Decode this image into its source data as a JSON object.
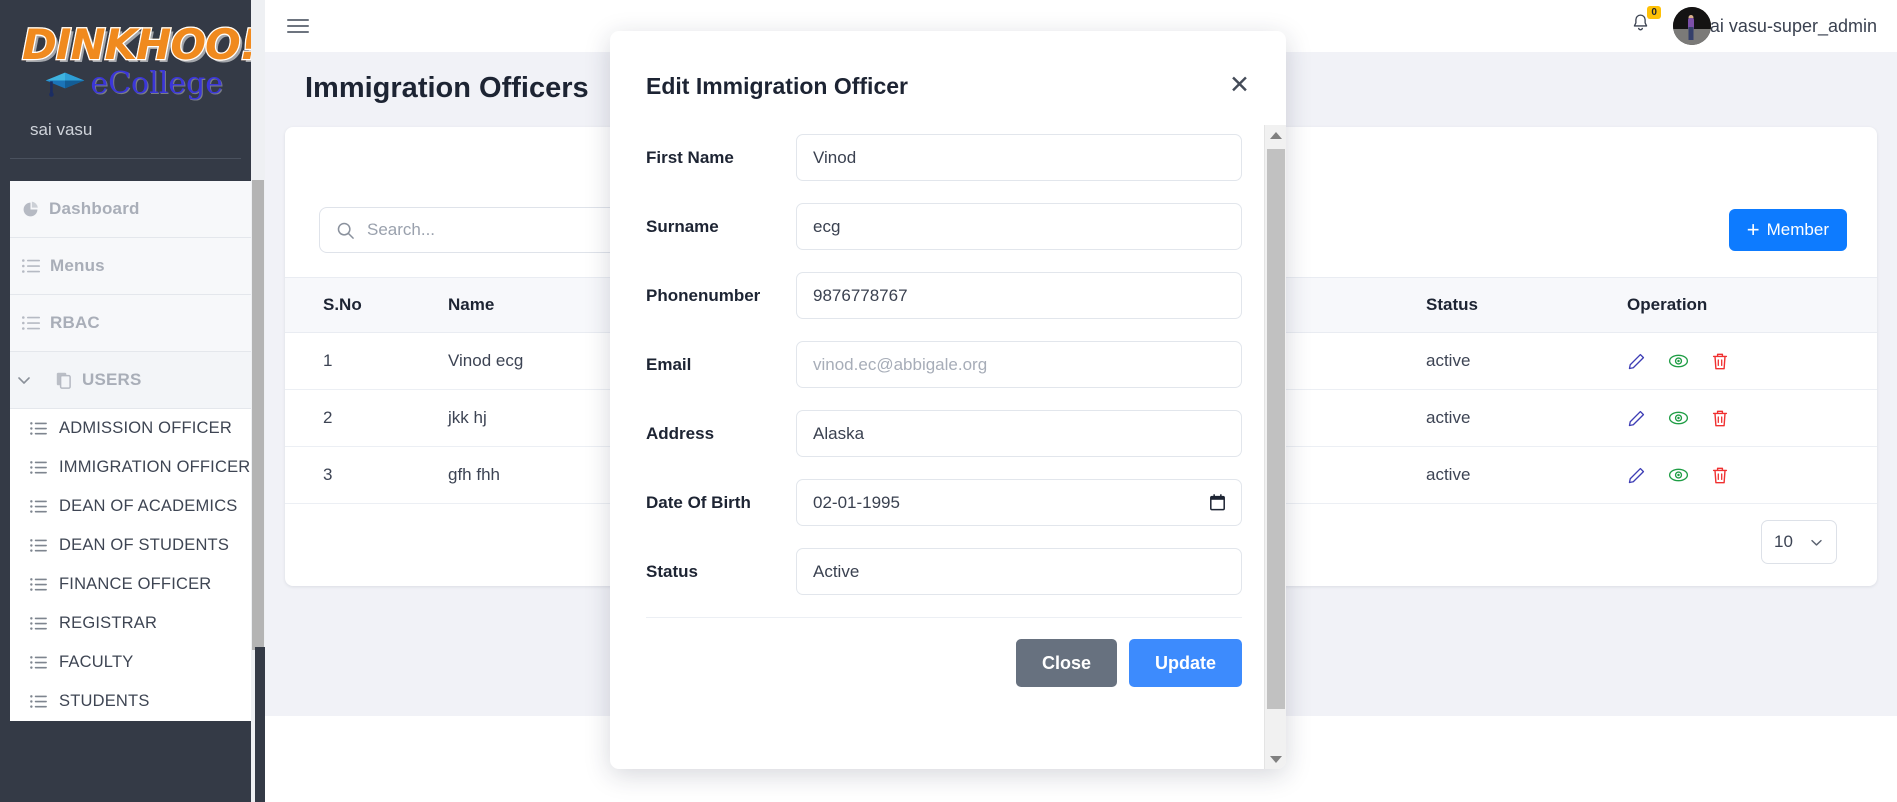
{
  "brand": {
    "word": "DINKHOO!",
    "sub": "eCollege",
    "cap_icon": "graduation-cap-icon",
    "user": "sai vasu"
  },
  "sidebar": {
    "groups": [
      {
        "label": "Dashboard",
        "icon": "pie-chart-icon",
        "expandable": false
      },
      {
        "label": "Menus",
        "icon": "list-icon",
        "expandable": false
      },
      {
        "label": "RBAC",
        "icon": "list-icon",
        "expandable": false
      },
      {
        "label": "USERS",
        "icon": "copy-icon",
        "expandable": true,
        "chevron": "chevron-down-icon"
      }
    ],
    "items": [
      {
        "label": "ADMISSION OFFICER",
        "icon": "list-icon"
      },
      {
        "label": "IMMIGRATION OFFICER",
        "icon": "list-icon"
      },
      {
        "label": "DEAN OF ACADEMICS",
        "icon": "list-icon"
      },
      {
        "label": "DEAN OF STUDENTS",
        "icon": "list-icon"
      },
      {
        "label": "FINANCE OFFICER",
        "icon": "list-icon"
      },
      {
        "label": "REGISTRAR",
        "icon": "list-icon"
      },
      {
        "label": "FACULTY",
        "icon": "list-icon"
      },
      {
        "label": "STUDENTS",
        "icon": "list-icon"
      }
    ]
  },
  "topbar": {
    "menu_icon": "hamburger-icon",
    "bell_icon": "bell-icon",
    "notification_count": "0",
    "avatar": "user-avatar",
    "user_label": "sai vasu-super_admin"
  },
  "page": {
    "title": "Immigration Officers",
    "search_placeholder": "Search...",
    "search_icon": "search-icon",
    "add_button": "Member",
    "add_button_plus": "+",
    "page_size": "10",
    "page_size_chevron": "chevron-down-icon"
  },
  "table": {
    "columns": [
      "S.No",
      "Name",
      "Status",
      "Operation"
    ],
    "rows": [
      {
        "sno": "1",
        "name": "Vinod ecg",
        "status": "active"
      },
      {
        "sno": "2",
        "name": "jkk hj",
        "status": "active"
      },
      {
        "sno": "3",
        "name": "gfh fhh",
        "status": "active"
      }
    ],
    "operations": [
      "edit-pencil-icon",
      "view-eye-icon",
      "delete-trash-icon"
    ]
  },
  "modal": {
    "title": "Edit Immigration Officer",
    "close_icon": "close-icon",
    "fields": [
      {
        "label": "First Name",
        "value": "Vinod",
        "is_placeholder": false
      },
      {
        "label": "Surname",
        "value": "ecg",
        "is_placeholder": false
      },
      {
        "label": "Phonenumber",
        "value": "9876778767",
        "is_placeholder": false
      },
      {
        "label": "Email",
        "value": "vinod.ec@abbigale.org",
        "is_placeholder": true
      },
      {
        "label": "Address",
        "value": "Alaska",
        "is_placeholder": false
      },
      {
        "label": "Date Of Birth",
        "value": "02-01-1995",
        "is_placeholder": false,
        "icon": "calendar-icon"
      },
      {
        "label": "Status",
        "value": "Active",
        "is_placeholder": false
      }
    ],
    "close_button": "Close",
    "update_button": "Update"
  },
  "colors": {
    "sidebar_bg": "#343a46",
    "accent_blue": "#0d7bff",
    "update_blue": "#3d8bfd",
    "close_gray": "#67717f",
    "badge_yellow": "#ffc107",
    "edit_icon": "#3d3db5",
    "view_icon": "#1f9d45",
    "delete_icon": "#f03030",
    "brand_orange": "#f08a1e",
    "brand_purple": "#3b36d8"
  }
}
